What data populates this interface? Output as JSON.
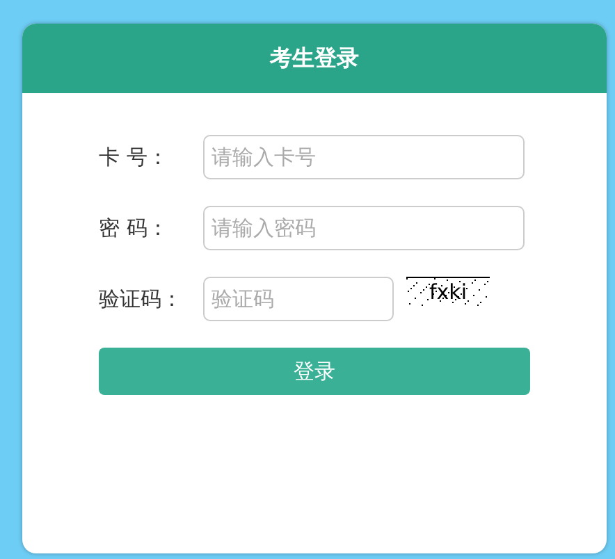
{
  "header": {
    "title": "考生登录"
  },
  "fields": [
    {
      "label": "卡 号：",
      "placeholder": "请输入卡号",
      "kind": "text"
    },
    {
      "label": "密 码：",
      "placeholder": "请输入密码",
      "kind": "password"
    },
    {
      "label": "验证码：",
      "placeholder": "验证码",
      "kind": "captcha",
      "captcha": "fxki"
    }
  ],
  "submit": "登录"
}
